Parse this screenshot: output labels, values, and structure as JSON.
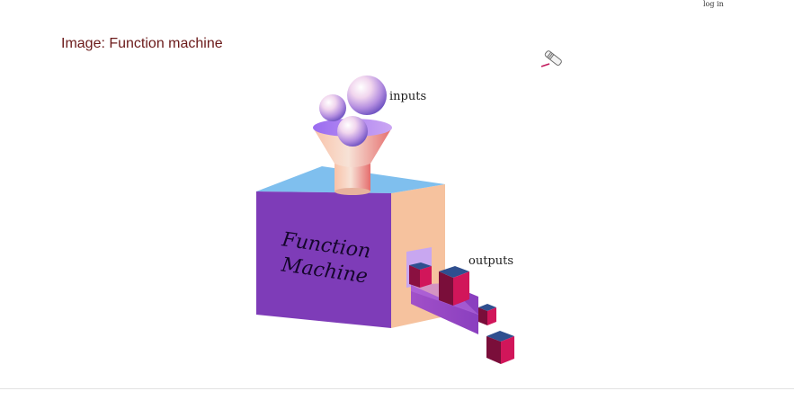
{
  "header": {
    "login_label": "log in"
  },
  "page": {
    "title": "Image: Function machine"
  },
  "figure": {
    "inputs_label": "inputs",
    "outputs_label": "outputs",
    "machine_line1": "Function",
    "machine_line2": "Machine"
  },
  "icons": {
    "edit": "pencil-icon"
  },
  "colors": {
    "title": "#6b1a1a",
    "box_front": "#7e3cb8",
    "box_top": "#7fbfee",
    "box_side": "#f6c29e",
    "cube_face": "#8a1040",
    "cube_top": "#2f4f8f"
  }
}
